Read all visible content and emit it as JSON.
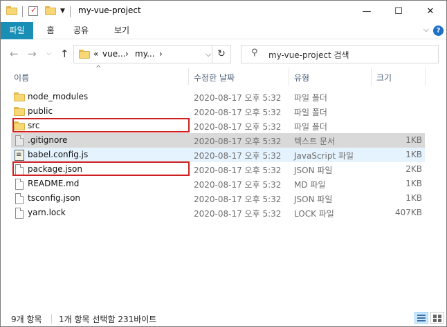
{
  "window": {
    "title": "my-vue-project",
    "controls": {
      "minimize": "—",
      "maximize": "☐",
      "close": "✕"
    }
  },
  "ribbon": {
    "tabs": [
      "파일",
      "홈",
      "공유",
      "보기"
    ],
    "collapse_glyph": "⌵",
    "help_glyph": "?"
  },
  "nav": {
    "back": "←",
    "forward": "→",
    "recent": "⌵",
    "up": "↑",
    "breadcrumb": [
      "«",
      "vue...",
      "›",
      "my...",
      "›"
    ],
    "dropdown": "⌵",
    "refresh": "↻",
    "search_placeholder": "my-vue-project 검색",
    "search_icon": "⚲"
  },
  "columns": {
    "name": "이름",
    "date": "수정한 날짜",
    "type": "유형",
    "size": "크기",
    "sort_indicator": "^"
  },
  "files": [
    {
      "name": "node_modules",
      "date": "2020-08-17 오후 5:32",
      "type": "파일 폴더",
      "size": "",
      "icon": "folder-icon"
    },
    {
      "name": "public",
      "date": "2020-08-17 오후 5:32",
      "type": "파일 폴더",
      "size": "",
      "icon": "folder-icon"
    },
    {
      "name": "src",
      "date": "2020-08-17 오후 5:32",
      "type": "파일 폴더",
      "size": "",
      "icon": "folder-icon"
    },
    {
      "name": ".gitignore",
      "date": "2020-08-17 오후 5:32",
      "type": "텍스트 문서",
      "size": "1KB",
      "icon": "text-file-icon"
    },
    {
      "name": "babel.config.js",
      "date": "2020-08-17 오후 5:32",
      "type": "JavaScript 파일",
      "size": "1KB",
      "icon": "js-file-icon"
    },
    {
      "name": "package.json",
      "date": "2020-08-17 오후 5:32",
      "type": "JSON 파일",
      "size": "2KB",
      "icon": "file-icon"
    },
    {
      "name": "README.md",
      "date": "2020-08-17 오후 5:32",
      "type": "MD 파일",
      "size": "1KB",
      "icon": "file-icon"
    },
    {
      "name": "tsconfig.json",
      "date": "2020-08-17 오후 5:32",
      "type": "JSON 파일",
      "size": "1KB",
      "icon": "file-icon"
    },
    {
      "name": "yarn.lock",
      "date": "2020-08-17 오후 5:32",
      "type": "LOCK 파일",
      "size": "407KB",
      "icon": "file-icon"
    }
  ],
  "status": {
    "item_count": "9개 항목",
    "selection": "1개 항목 선택함 231바이트"
  },
  "colors": {
    "file_tab": "#1a8fb5",
    "highlight_box": "#d01f1f",
    "selected_row": "#d9d9d9",
    "hover_row": "#e5f3ff"
  }
}
